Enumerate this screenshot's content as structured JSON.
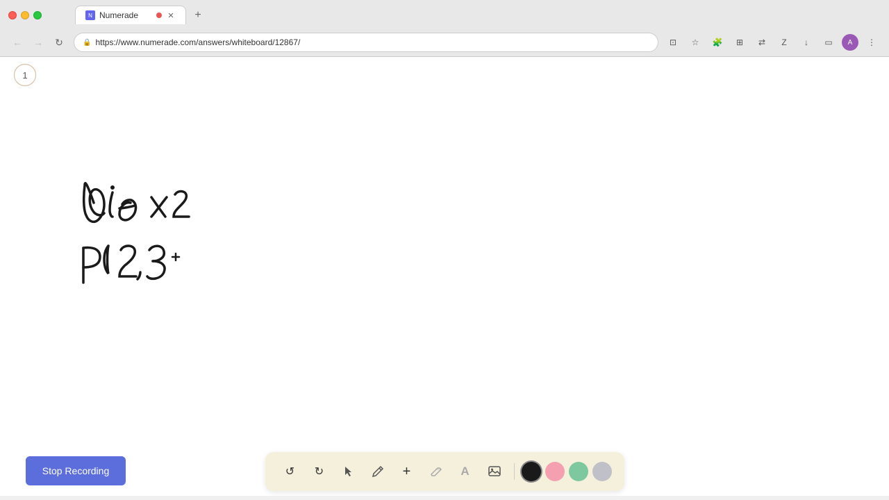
{
  "browser": {
    "tab": {
      "favicon_label": "N",
      "title": "Numerade",
      "has_dot": true
    },
    "url": "https://www.numerade.com/answers/whiteboard/12867/",
    "lock_icon": "🔒"
  },
  "page": {
    "page_number": "1"
  },
  "toolbar": {
    "stop_recording_label": "Stop Recording",
    "tools": [
      {
        "id": "undo",
        "icon": "↺",
        "label": "undo"
      },
      {
        "id": "redo",
        "icon": "↻",
        "label": "redo"
      },
      {
        "id": "select",
        "icon": "▲",
        "label": "select"
      },
      {
        "id": "pen",
        "icon": "✏",
        "label": "pen"
      },
      {
        "id": "add",
        "icon": "+",
        "label": "add"
      },
      {
        "id": "eraser",
        "icon": "✂",
        "label": "eraser"
      },
      {
        "id": "text",
        "icon": "A",
        "label": "text"
      },
      {
        "id": "image",
        "icon": "🖼",
        "label": "image"
      }
    ],
    "colors": [
      {
        "id": "black",
        "value": "#1a1a1a",
        "selected": true
      },
      {
        "id": "pink",
        "value": "#f4a0b0"
      },
      {
        "id": "green",
        "value": "#7ec8a0"
      },
      {
        "id": "gray",
        "value": "#c0c0c8"
      }
    ]
  },
  "math_content": {
    "line1": "die x2",
    "line2": "P( 2, 3,"
  }
}
